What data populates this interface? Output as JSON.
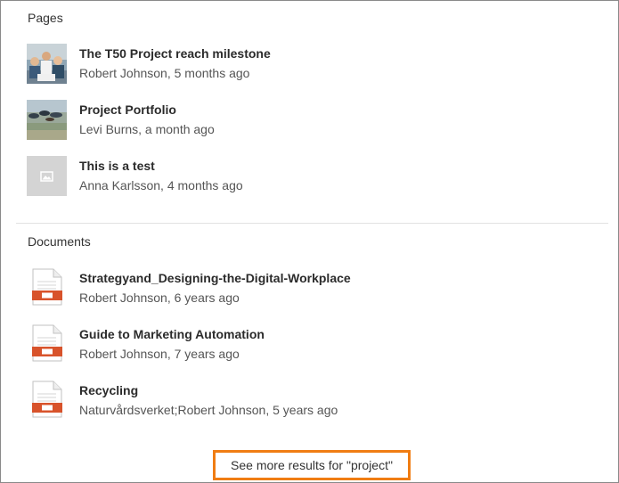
{
  "pages": {
    "heading": "Pages",
    "items": [
      {
        "title": "The T50 Project reach milestone",
        "meta": "Robert Johnson, 5 months ago",
        "thumbnail": "team-photo"
      },
      {
        "title": "Project Portfolio",
        "meta": "Levi Burns, a month ago",
        "thumbnail": "skydivers-photo"
      },
      {
        "title": "This is a test",
        "meta": "Anna Karlsson, 4 months ago",
        "thumbnail": "image-placeholder-icon"
      }
    ]
  },
  "documents": {
    "heading": "Documents",
    "items": [
      {
        "title": "Strategyand_Designing-the-Digital-Workplace",
        "meta": "Robert Johnson, 6 years ago",
        "icon": "powerpoint-file-icon"
      },
      {
        "title": "Guide to Marketing Automation",
        "meta": "Robert Johnson, 7 years ago",
        "icon": "powerpoint-file-icon"
      },
      {
        "title": "Recycling",
        "meta": "Naturvårdsverket;Robert Johnson, 5 years ago",
        "icon": "powerpoint-file-icon"
      }
    ]
  },
  "see_more": {
    "label": "See more results for \"project\""
  },
  "colors": {
    "highlight": "#f07d13",
    "doc_accent": "#d8532b"
  }
}
